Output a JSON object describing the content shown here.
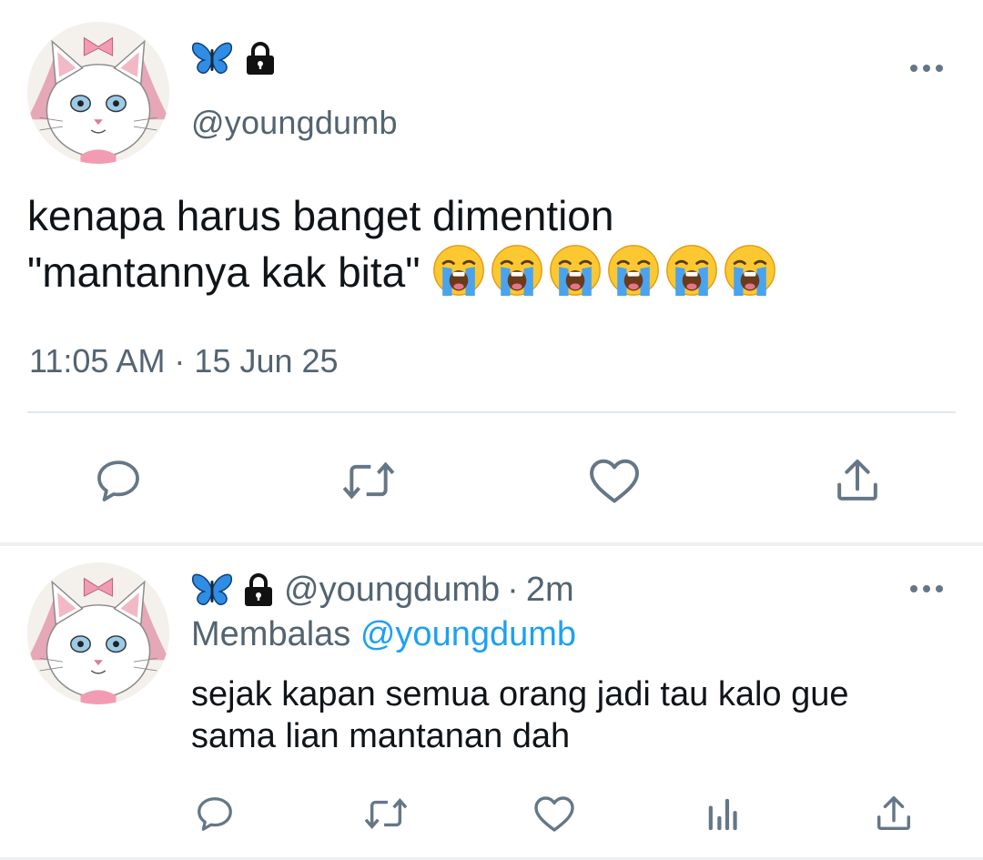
{
  "tweet": {
    "display_name_icons": [
      "blue-butterfly-icon",
      "lock-icon"
    ],
    "handle": "@youngdumb",
    "text_line1": "kenapa harus banget dimention",
    "text_line2": "\"mantannya kak bita\"",
    "emoji": [
      "loudly-crying-face-icon",
      "loudly-crying-face-icon",
      "loudly-crying-face-icon",
      "loudly-crying-face-icon",
      "loudly-crying-face-icon",
      "loudly-crying-face-icon"
    ],
    "timestamp": "11:05 AM · 15 Jun 25",
    "actions": [
      "reply-icon",
      "retweet-icon",
      "like-icon",
      "share-icon"
    ]
  },
  "reply": {
    "display_name_icons": [
      "blue-butterfly-icon",
      "lock-icon"
    ],
    "handle": "@youngdumb",
    "separator": "·",
    "time_ago": "2m",
    "replying_label": "Membalas",
    "replying_to": "@youngdumb",
    "text": "sejak kapan semua orang jadi tau kalo gue sama lian mantanan dah",
    "actions": [
      "reply-icon",
      "retweet-icon",
      "like-icon",
      "analytics-icon",
      "share-icon"
    ]
  },
  "colors": {
    "text_primary": "#0f1419",
    "text_secondary": "#536471",
    "mention": "#1da1f2",
    "divider": "#e1e8ed"
  }
}
